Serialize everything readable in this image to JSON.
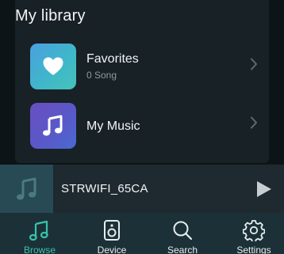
{
  "library": {
    "title": "My library",
    "items": [
      {
        "label": "Favorites",
        "sub": "0 Song",
        "icon": "heart-icon"
      },
      {
        "label": "My Music",
        "icon": "music-note-icon"
      }
    ]
  },
  "player": {
    "title": "STRWIFI_65CA",
    "icons": {
      "art": "music-note-icon",
      "play": "play-icon"
    }
  },
  "tabs": [
    {
      "label": "Browse",
      "icon": "music-note-icon",
      "active": true
    },
    {
      "label": "Device",
      "icon": "speaker-icon",
      "active": false
    },
    {
      "label": "Search",
      "icon": "search-icon",
      "active": false
    },
    {
      "label": "Settings",
      "icon": "gear-icon",
      "active": false
    }
  ],
  "colors": {
    "accent": "#38c2ad",
    "background": "#0c1418",
    "panel": "#182126",
    "tabbar": "#1c3137",
    "player": "#1e2a30",
    "subtext": "#8f999e"
  }
}
